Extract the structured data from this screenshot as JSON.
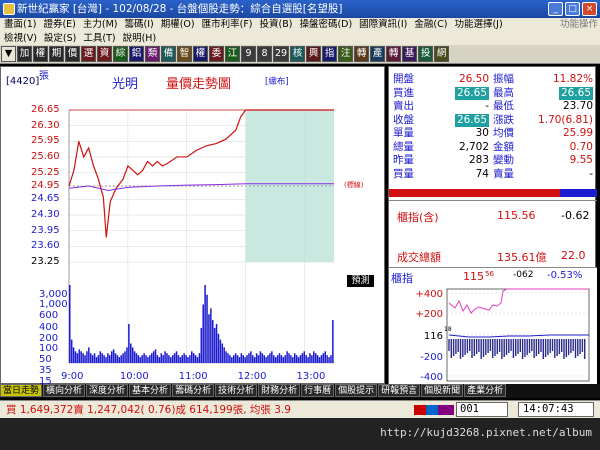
{
  "window": {
    "title": "新世紀贏家 [台灣] - 102/08/28 - 台盤個股走勢：綜合自選股[名望股]"
  },
  "menu": {
    "items": [
      "畫面(1)",
      "證券(E)",
      "主力(M)",
      "籌碼(I)",
      "期權(O)",
      "匯市利率(F)",
      "投資(B)",
      "操盤密碼(D)",
      "國際資訊(I)",
      "金融(C)",
      "功能選擇(J)"
    ],
    "items2": [
      "檢視(V)",
      "設定(S)",
      "工具(T)",
      "說明(H)"
    ],
    "right": "功能操作"
  },
  "toolbar": {
    "buttons": [
      "▼",
      "加",
      "權",
      "期",
      "價",
      "選",
      "資",
      "綜",
      "鋁",
      "類",
      "備",
      "智",
      "權",
      "委",
      "江",
      "9",
      "8",
      "29",
      "核",
      "興",
      "指",
      "注",
      "轉",
      "產",
      "轉",
      "基",
      "投",
      "網"
    ]
  },
  "chart": {
    "code": "[4420]",
    "name": "光明",
    "title": "量價走勢圖",
    "layout_label": "[織布]",
    "price_ticks": [
      "26.65",
      "26.30",
      "25.95",
      "25.60",
      "25.25",
      "24.95",
      "24.65",
      "24.30",
      "23.95",
      "23.60",
      "23.25"
    ],
    "volume_ticks": [
      "3,000",
      "1,000",
      "600",
      "400",
      "200",
      "100",
      "50",
      "35",
      "15",
      "張"
    ],
    "time_ticks": [
      "9:00",
      "10:00",
      "11:00",
      "12:00",
      "13:00"
    ],
    "ref_label": "(標線)",
    "predict_label": "預測"
  },
  "chart_data": {
    "type": "line",
    "series": [
      {
        "values": [
          [
            0,
            24.95
          ],
          [
            5,
            25.3
          ],
          [
            10,
            25.95
          ],
          [
            15,
            25.6
          ],
          [
            20,
            25.8
          ],
          [
            25,
            25.4
          ],
          [
            30,
            25.1
          ],
          [
            35,
            24.7
          ],
          [
            38,
            23.8
          ],
          [
            42,
            24.6
          ],
          [
            48,
            24.9
          ],
          [
            55,
            25.1
          ],
          [
            60,
            25.4
          ],
          [
            65,
            25.3
          ],
          [
            70,
            25.2
          ],
          [
            75,
            25.3
          ],
          [
            80,
            25.5
          ],
          [
            85,
            25.4
          ],
          [
            90,
            25.5
          ],
          [
            95,
            25.4
          ],
          [
            100,
            25.45
          ],
          [
            110,
            25.6
          ],
          [
            120,
            25.6
          ],
          [
            130,
            25.75
          ],
          [
            140,
            25.85
          ],
          [
            150,
            25.9
          ],
          [
            160,
            26.0
          ],
          [
            170,
            26.2
          ],
          [
            175,
            26.5
          ],
          [
            180,
            26.65
          ],
          [
            270,
            26.65
          ]
        ]
      },
      {
        "values": [
          [
            0,
            24.9
          ],
          [
            20,
            24.95
          ],
          [
            40,
            24.85
          ],
          [
            60,
            24.92
          ],
          [
            90,
            24.95
          ],
          [
            120,
            24.97
          ],
          [
            150,
            24.98
          ],
          [
            180,
            25.0
          ],
          [
            270,
            25.0
          ]
        ]
      }
    ],
    "x_range_minutes": [
      0,
      270
    ],
    "price_range": [
      23.25,
      26.65
    ],
    "reference_price": 24.95,
    "volume_bars": [
      40,
      12,
      8,
      6,
      5,
      7,
      6,
      5,
      4,
      6,
      8,
      5,
      4,
      5,
      3,
      4,
      6,
      5,
      4,
      3,
      5,
      4,
      6,
      7,
      5,
      4,
      3,
      4,
      5,
      6,
      8,
      20,
      10,
      8,
      6,
      5,
      4,
      3,
      4,
      5,
      4,
      3,
      4,
      5,
      6,
      7,
      4,
      3,
      5,
      4,
      6,
      5,
      4,
      3,
      4,
      5,
      6,
      4,
      3,
      4,
      5,
      4,
      3,
      4,
      6,
      5,
      4,
      3,
      5,
      18,
      30,
      40,
      35,
      25,
      28,
      22,
      18,
      20,
      15,
      12,
      10,
      8,
      6,
      5,
      4,
      3,
      4,
      5,
      4,
      3,
      5,
      4,
      3,
      4,
      5,
      6,
      4,
      3,
      5,
      4,
      6,
      5,
      4,
      3,
      4,
      5,
      6,
      4,
      3,
      4,
      5,
      4,
      3,
      4,
      6,
      5,
      4,
      3,
      5,
      4,
      3,
      4,
      5,
      6,
      4,
      3,
      5,
      4,
      6,
      5,
      4,
      3,
      4,
      5,
      6,
      4,
      3,
      4,
      22
    ]
  },
  "quote": {
    "rows": [
      {
        "l1": "開盤",
        "v1": "26.50",
        "l2": "振幅",
        "v2": "11.82%",
        "c1": "red",
        "c2": "red"
      },
      {
        "l1": "買進",
        "v1": "26.65",
        "l2": "最高",
        "v2": "26.65",
        "c1": "hl",
        "c2": "hl"
      },
      {
        "l1": "賣出",
        "v1": "-",
        "l2": "最低",
        "v2": "23.70",
        "c1": "",
        "c2": ""
      },
      {
        "l1": "收盤",
        "v1": "26.65",
        "l2": "漲跌",
        "v2": "1.70(6.81)",
        "c1": "hl",
        "c2": "red"
      },
      {
        "l1": "單量",
        "v1": "30",
        "l2": "均價",
        "v2": "25.99",
        "c1": "",
        "c2": "red"
      },
      {
        "l1": "總量",
        "v1": "2,702",
        "l2": "金額",
        "v2": "0.70",
        "c1": "",
        "c2": "red"
      },
      {
        "l1": "昨量",
        "v1": "283",
        "l2": "變動",
        "v2": "9.55",
        "c1": "",
        "c2": "red"
      },
      {
        "l1": "買量",
        "v1": "74",
        "l2": "賣量",
        "v2": "-",
        "c1": "",
        "c2": ""
      }
    ],
    "index_label": "櫃指(含)",
    "index_value": "115.56",
    "index_change": "-0.62",
    "total_label": "成交總額",
    "total_value": "135.61億",
    "total_change": "22.0",
    "mini": {
      "label": "櫃指",
      "value": "115",
      "value_dec": "56",
      "change": "-062",
      "pct": "-0.53%",
      "ticks": [
        "+400",
        "+200",
        "116",
        "-200",
        "-400"
      ],
      "mid": "18"
    }
  },
  "tabs": [
    "當日走勢",
    "橫向分析",
    "深度分析",
    "基本分析",
    "籌碼分析",
    "技術分析",
    "財務分析",
    "行事曆",
    "個股提示",
    "研報預言",
    "個股新聞",
    "產業分析"
  ],
  "status": {
    "text": "買 1,649,372賣 1,247,042( 0.76)成 614,199張, 均張 3.9",
    "field": "001",
    "time": "14:07:43"
  },
  "watermark": "http://kujd3268.pixnet.net/album"
}
